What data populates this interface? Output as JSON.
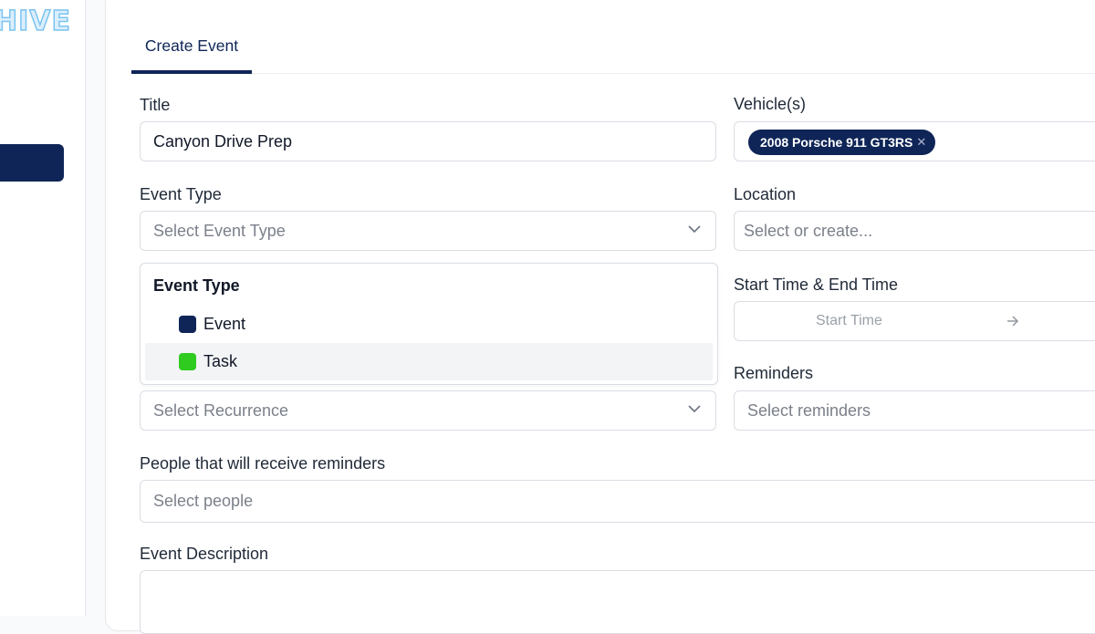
{
  "sidebar": {
    "logo_text": "HIVE",
    "logo_colors": {
      "fill": "#dbeefe",
      "stroke": "#7cc4ef"
    },
    "active_item_color": "#0f2557"
  },
  "tabs": [
    {
      "label": "Create Event",
      "active": true
    }
  ],
  "form": {
    "title": {
      "label": "Title",
      "value": "Canyon Drive Prep"
    },
    "vehicles": {
      "label": "Vehicle(s)",
      "chips": [
        {
          "label": "2008 Porsche 911 GT3RS",
          "remove_icon": "close-icon"
        }
      ]
    },
    "event_type": {
      "label": "Event Type",
      "placeholder": "Select Event Type",
      "icon": "chevron-down-icon"
    },
    "location": {
      "label": "Location",
      "placeholder": "Select or create..."
    },
    "event_type_dropdown": {
      "heading": "Event Type",
      "options": [
        {
          "label": "Event",
          "color": "#0f2557"
        },
        {
          "label": "Task",
          "color": "#2fcb1f",
          "hovered": true
        }
      ]
    },
    "time": {
      "label": "Start Time & End Time",
      "start_placeholder": "Start Time",
      "arrow_icon": "arrow-right-icon"
    },
    "recurrence": {
      "placeholder": "Select Recurrence",
      "icon": "chevron-down-icon"
    },
    "reminders": {
      "label": "Reminders",
      "placeholder": "Select reminders"
    },
    "people": {
      "label": "People that will receive reminders",
      "placeholder": "Select people"
    },
    "description": {
      "label": "Event Description",
      "value": ""
    }
  },
  "colors": {
    "accent": "#0f2557",
    "border": "#d9dde3",
    "placeholder_text": "#7b808a"
  }
}
